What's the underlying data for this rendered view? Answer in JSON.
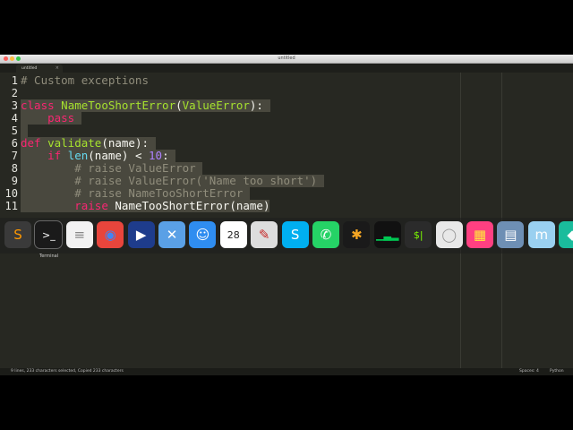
{
  "window": {
    "title": "untitled"
  },
  "tab": {
    "label": "untitled",
    "close_glyph": "×"
  },
  "editor": {
    "line_numbers": [
      "1",
      "2",
      "3",
      "4",
      "5",
      "6",
      "7",
      "8",
      "9",
      "10",
      "11"
    ],
    "lines": {
      "l1": "# Custom exceptions",
      "l3_kw": "class",
      "l3_name": "NameTooShortError",
      "l3_open": "(",
      "l3_base": "ValueError",
      "l3_close": "):",
      "l4": "    pass",
      "l6_kw": "def",
      "l6_name": "validate",
      "l6_args": "(name):",
      "l7_kw": "if",
      "l7_fn": "len",
      "l7_mid": "(name) < ",
      "l7_num": "10",
      "l7_end": ":",
      "l8": "# raise ValueError",
      "l9": "# raise ValueError('Name too short')",
      "l10": "# raise NameTooShortError",
      "l11_kw": "raise",
      "l11_rest": "NameTooShortError(name)"
    }
  },
  "dock": {
    "tooltip": "Terminal",
    "icons": [
      {
        "name": "sublime-text-icon",
        "glyph": "S",
        "bg": "#3a3a3a",
        "fg": "#ff9800"
      },
      {
        "name": "terminal-icon",
        "glyph": ">_",
        "bg": "#1a1a1a",
        "fg": "#ffffff"
      },
      {
        "name": "notes-icon",
        "glyph": "≡",
        "bg": "#f2f2f2",
        "fg": "#888888"
      },
      {
        "name": "chrome-icon",
        "glyph": "◉",
        "bg": "#e8453c",
        "fg": "#4285f4"
      },
      {
        "name": "screenflow-icon",
        "glyph": "▶",
        "bg": "#1e3c8c",
        "fg": "#ffffff"
      },
      {
        "name": "network-utility-icon",
        "glyph": "✕",
        "bg": "#5aa0e6",
        "fg": "#ffffff"
      },
      {
        "name": "finder-icon",
        "glyph": "☺",
        "bg": "#2f8df0",
        "fg": "#ffffff"
      },
      {
        "name": "calendar-icon",
        "glyph": "28",
        "bg": "#ffffff",
        "fg": "#222222"
      },
      {
        "name": "pencil-app-icon",
        "glyph": "✎",
        "bg": "#dddddd",
        "fg": "#c62828"
      },
      {
        "name": "skype-icon",
        "glyph": "S",
        "bg": "#00aff0",
        "fg": "#ffffff"
      },
      {
        "name": "whatsapp-icon",
        "glyph": "✆",
        "bg": "#25d366",
        "fg": "#ffffff"
      },
      {
        "name": "tes-icon",
        "glyph": "✱",
        "bg": "#1a1a1a",
        "fg": "#f5a623"
      },
      {
        "name": "activity-monitor-icon",
        "glyph": "▁▃▂",
        "bg": "#111111",
        "fg": "#00c853"
      },
      {
        "name": "console-icon",
        "glyph": "$|",
        "bg": "#2b2b2b",
        "fg": "#7cfc00"
      },
      {
        "name": "disk-utility-icon",
        "glyph": "◯",
        "bg": "#e8e8e8",
        "fg": "#999999"
      },
      {
        "name": "color-picker-icon",
        "glyph": "▦",
        "bg": "#ff4081",
        "fg": "#ffeb3b"
      },
      {
        "name": "preview-icon",
        "glyph": "▤",
        "bg": "#6e8fb4",
        "fg": "#ffffff"
      },
      {
        "name": "mindmap-icon",
        "glyph": "m",
        "bg": "#9ad0f0",
        "fg": "#ffffff"
      },
      {
        "name": "extra-app-icon",
        "glyph": "◆",
        "bg": "#1abc9c",
        "fg": "#ffffff"
      }
    ]
  },
  "statusbar": {
    "left": "9 lines, 233 characters selected, Copied 233 characters",
    "indentation": "Spaces: 4",
    "syntax": "Python"
  }
}
